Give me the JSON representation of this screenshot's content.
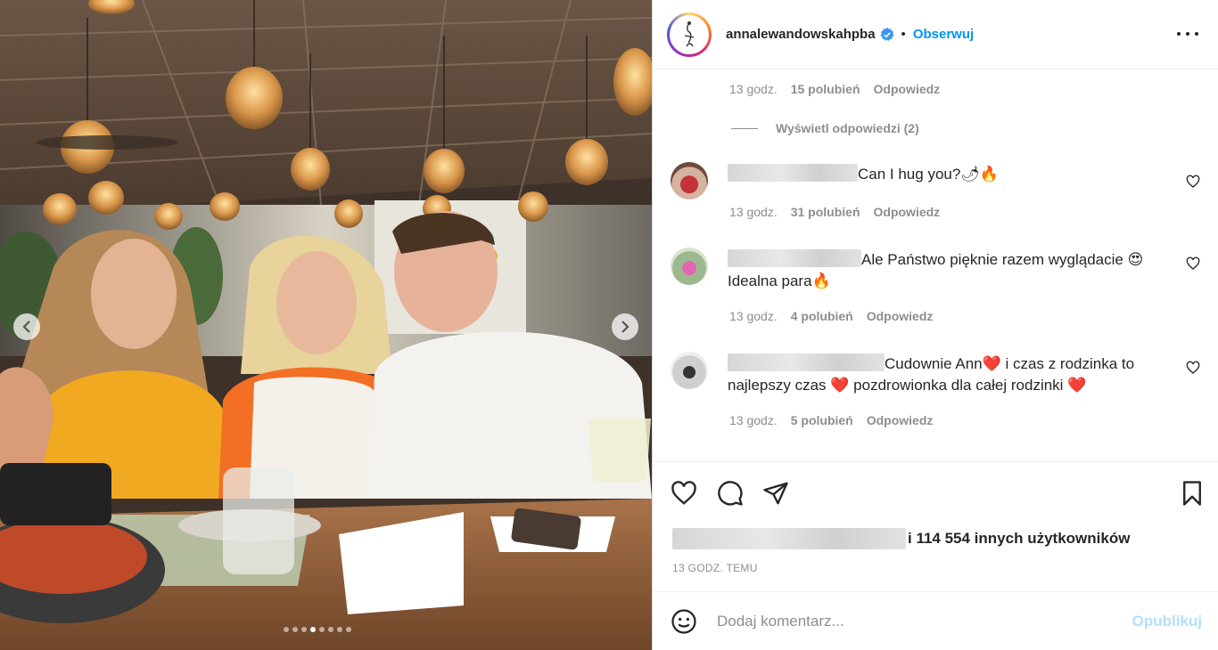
{
  "header": {
    "username": "annalewandowskahpba",
    "separator": "•",
    "follow_label": "Obserwuj"
  },
  "comments": {
    "prev_meta": {
      "time": "13 godz.",
      "likes": "15 polubień",
      "reply": "Odpowiedz"
    },
    "view_replies": "Wyświetl odpowiedzi (2)",
    "items": [
      {
        "text": "Can I hug you?🌶🔥",
        "time": "13 godz.",
        "likes": "31 polubień",
        "reply": "Odpowiedz"
      },
      {
        "text": "Ale Państwo pięknie razem wyglądacie 😍",
        "text2": "Idealna para🔥",
        "time": "13 godz.",
        "likes": "4 polubień",
        "reply": "Odpowiedz"
      },
      {
        "text": "Cudownie Ann❤️ i czas z rodzinka to",
        "text2": "najlepszy czas ❤️ pozdrowionka dla całej rodzinki ❤️",
        "time": "13 godz.",
        "likes": "5 polubień",
        "reply": "Odpowiedz"
      }
    ]
  },
  "post": {
    "likes_text": "i 114 554 innych użytkowników",
    "timestamp": "13 GODZ. TEMU"
  },
  "add_comment": {
    "placeholder": "Dodaj komentarz...",
    "publish_label": "Opublikuj"
  },
  "carousel": {
    "slide_count": 8,
    "active_index": 3
  },
  "colors": {
    "accent": "#0095f6",
    "muted": "#8e8e8e",
    "text": "#262626",
    "publish_disabled": "#b2dffc"
  },
  "icons": [
    "chevron-left-icon",
    "chevron-right-icon",
    "verified-icon",
    "more-icon",
    "heart-icon",
    "comment-icon",
    "share-icon",
    "bookmark-icon",
    "emoji-icon"
  ]
}
